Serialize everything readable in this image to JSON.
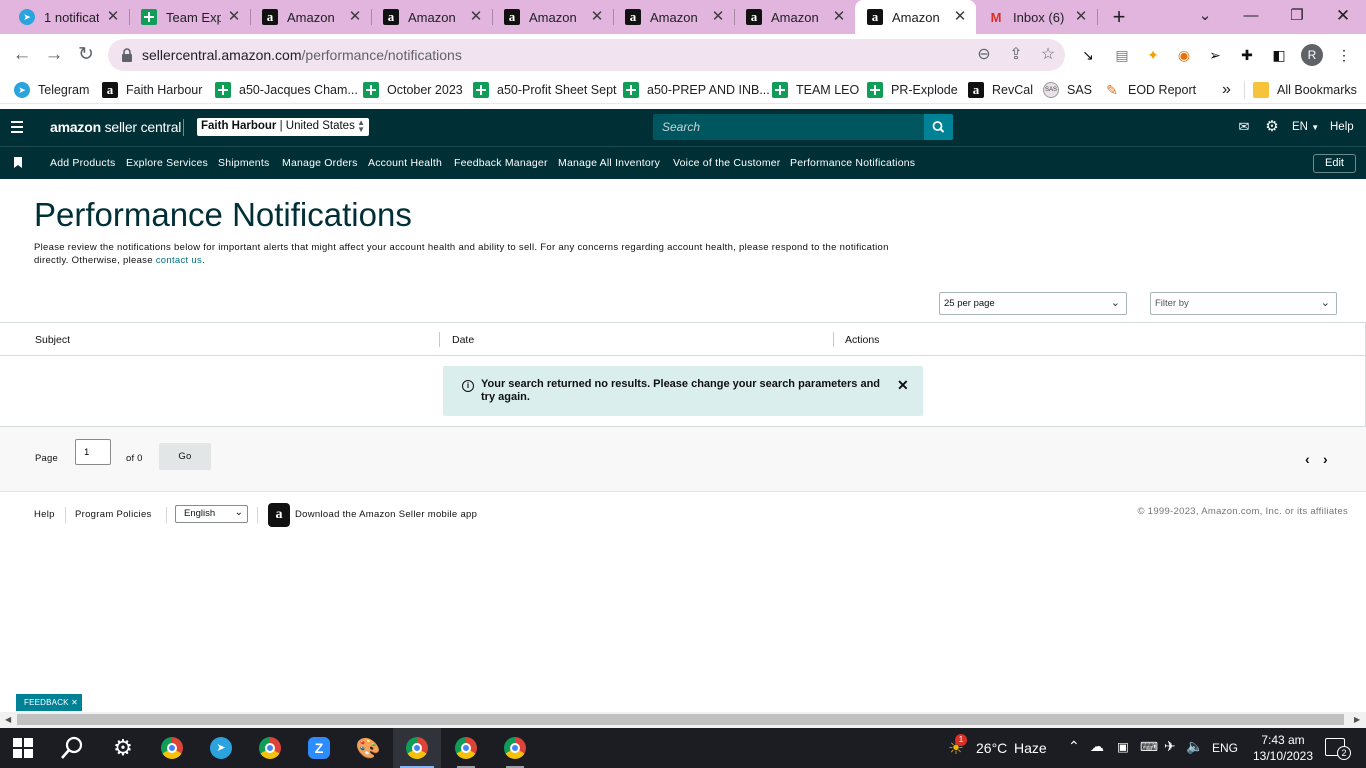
{
  "browser": {
    "tabs": [
      {
        "title": "1 notificat",
        "icon": "telegram-icon",
        "active": false
      },
      {
        "title": "Team Expl",
        "icon": "sheets-icon",
        "active": false
      },
      {
        "title": "Amazon",
        "icon": "amazon-icon",
        "active": false
      },
      {
        "title": "Amazon",
        "icon": "amazon-icon",
        "active": false
      },
      {
        "title": "Amazon",
        "icon": "amazon-icon",
        "active": false
      },
      {
        "title": "Amazon",
        "icon": "amazon-icon",
        "active": false
      },
      {
        "title": "Amazon",
        "icon": "amazon-icon",
        "active": false
      },
      {
        "title": "Amazon",
        "icon": "amazon-icon",
        "active": true
      },
      {
        "title": "Inbox (6)",
        "icon": "gmail-icon",
        "active": false
      }
    ],
    "url_host": "sellercentral.amazon.com",
    "url_path": "/performance/notifications",
    "bookmarks": [
      {
        "label": "Telegram",
        "icon": "telegram-icon"
      },
      {
        "label": "Faith Harbour",
        "icon": "amazon-icon"
      },
      {
        "label": "a50-Jacques Cham...",
        "icon": "sheets-icon"
      },
      {
        "label": "October 2023",
        "icon": "sheets-icon"
      },
      {
        "label": "a50-Profit Sheet Sept",
        "icon": "sheets-icon"
      },
      {
        "label": "a50-PREP AND INB...",
        "icon": "sheets-icon"
      },
      {
        "label": "TEAM LEO",
        "icon": "sheets-icon"
      },
      {
        "label": "PR-Explode",
        "icon": "sheets-icon"
      },
      {
        "label": "RevCal",
        "icon": "amazon-icon"
      },
      {
        "label": "SAS",
        "icon": "sas-icon"
      },
      {
        "label": "EOD Report",
        "icon": "eod-icon"
      }
    ],
    "more_bookmarks": "»",
    "all_bookmarks": "All Bookmarks",
    "profile_initial": "R"
  },
  "header": {
    "logo_bold": "amazon",
    "logo_rest": " seller central",
    "account_name": "Faith Harbour",
    "marketplace": "United States",
    "search_placeholder": "Search",
    "language": "EN",
    "help": "Help"
  },
  "nav": {
    "items": [
      "Add Products",
      "Explore Services",
      "Shipments",
      "Manage Orders",
      "Account Health",
      "Feedback Manager",
      "Manage All Inventory",
      "Voice of the Customer",
      "Performance Notifications"
    ],
    "edit": "Edit"
  },
  "page": {
    "title": "Performance Notifications",
    "description": "Please review the notifications below for important alerts that might affect your account health and ability to sell. For any concerns regarding account health, please respond to the notification directly. Otherwise, please ",
    "contact_link": "contact us",
    "per_page": "25 per page",
    "filter_placeholder": "Filter by",
    "columns": [
      "Subject",
      "Date",
      "Actions"
    ],
    "alert_message": "Your search returned no results. Please change your search parameters and try again.",
    "page_label": "Page",
    "page_value": "1",
    "of_label": "of 0",
    "go": "Go"
  },
  "footer": {
    "help": "Help",
    "program_policies": "Program Policies",
    "language": "English",
    "download_app": "Download the Amazon Seller mobile app",
    "copyright": "© 1999-2023, Amazon.com, Inc. or its affiliates",
    "feedback": "FEEDBACK"
  },
  "taskbar": {
    "temperature": "26°C",
    "weather": "Haze",
    "weather_badge": "1",
    "input_lang": "ENG",
    "time": "7:43 am",
    "date": "13/10/2023",
    "notifications": "2"
  },
  "colors": {
    "header_bg": "#002f36",
    "link": "#007185",
    "alert_bg": "#dbeeee",
    "search_button": "#008296"
  }
}
